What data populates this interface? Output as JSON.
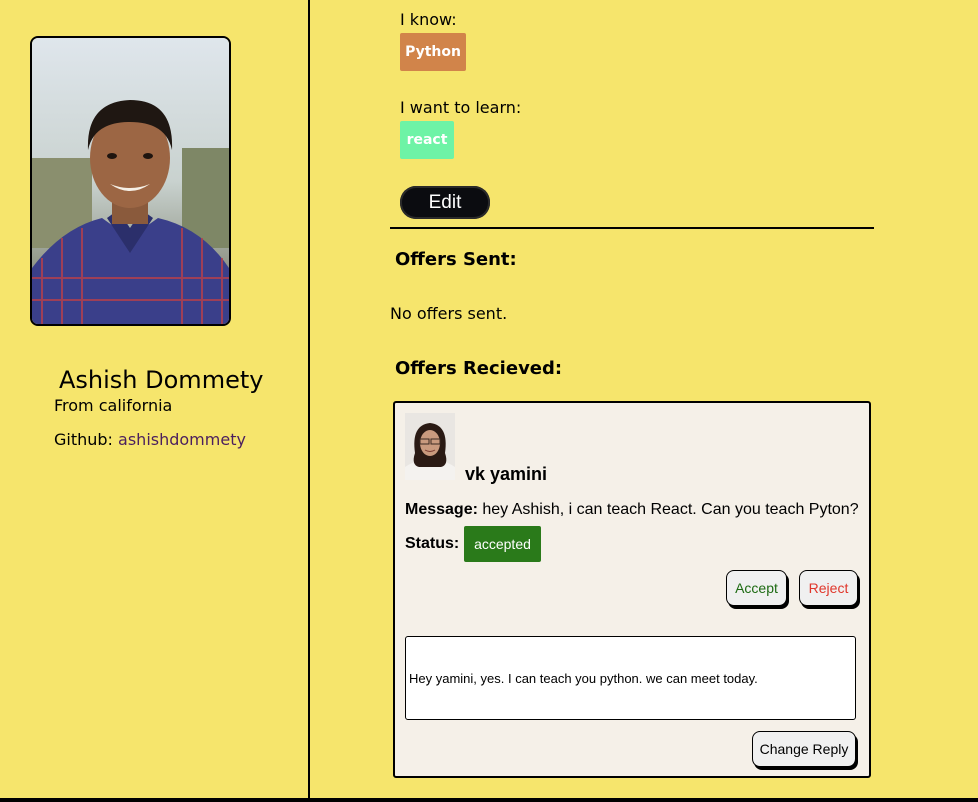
{
  "profile": {
    "name": "Ashish Dommety",
    "location": "From california",
    "github_label": "Github: ",
    "github_handle": "ashishdommety"
  },
  "skills": {
    "know_label": "I know:",
    "know": [
      "Python"
    ],
    "learn_label": "I want to learn:",
    "learn": [
      "react"
    ],
    "edit_label": "Edit"
  },
  "offers_sent": {
    "title": "Offers Sent:",
    "empty_text": "No offers sent."
  },
  "offers_received": {
    "title": "Offers Recieved:",
    "items": [
      {
        "name": "vk yamini",
        "message_label": "Message:",
        "message": "hey Ashish, i can teach React. Can you teach Pyton?",
        "status_label": "Status:",
        "status": "accepted",
        "accept_label": "Accept",
        "reject_label": "Reject",
        "reply": "Hey yamini, yes. I can teach you python. we can meet today.",
        "change_reply_label": "Change Reply"
      }
    ]
  },
  "colors": {
    "background": "#f6e56c",
    "know_tag": "#d1844a",
    "learn_tag": "#6ef3a6",
    "status_accepted": "#2a7a1a",
    "accept_text": "#1c6a12",
    "reject_text": "#e0362b"
  }
}
